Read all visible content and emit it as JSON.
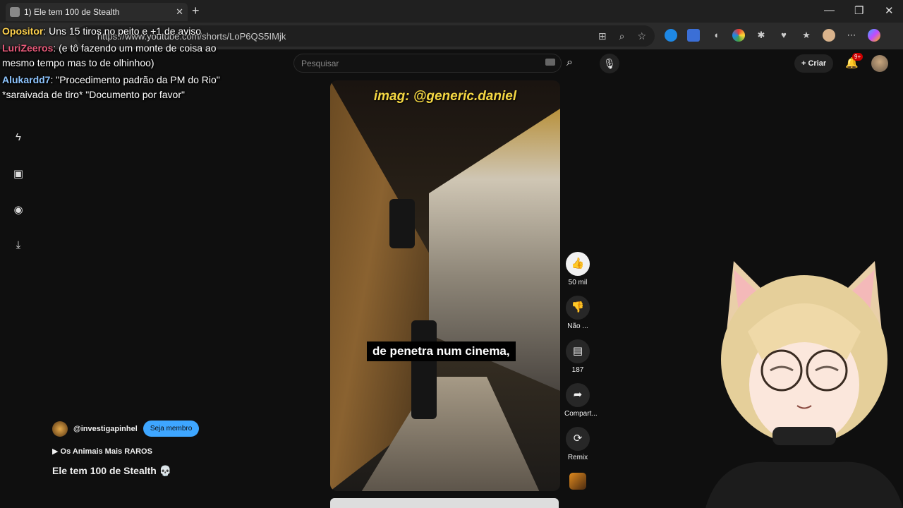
{
  "browser": {
    "tab_title": "1) Ele tem 100 de Stealth",
    "url": "https://www.youtube.com/shorts/LoP6QS5IMjk"
  },
  "youtube": {
    "search_placeholder": "Pesquisar",
    "create_label": "Criar",
    "notification_count": "9+"
  },
  "chat": [
    {
      "name": "Opositor",
      "text": "Uns 15 tiros no peito e +1 de aviso"
    },
    {
      "name": "LuriZeeros",
      "text": "(e tô fazendo um monte de coisa ao mesmo tempo mas to de olhinhoo)"
    },
    {
      "name": "Alukardd7",
      "text": "\"Procedimento padrão da PM do Rio\" *saraivada de tiro* \"Documento por favor\""
    }
  ],
  "video": {
    "watermark": "imag: @generic.daniel",
    "caption": "de penetra num cinema,"
  },
  "actions": {
    "likes": "50 mil",
    "dislike": "Não ...",
    "comments": "187",
    "share": "Compart...",
    "remix": "Remix"
  },
  "channel": {
    "handle": "@investigapinhel",
    "member_button": "Seja membro",
    "playlist": "Os Animais Mais RAROS",
    "title": "Ele tem 100 de Stealth 💀"
  },
  "colors": {
    "accent": "#3ea6ff",
    "badge": "#cc0000",
    "watermark": "#f4d743"
  }
}
